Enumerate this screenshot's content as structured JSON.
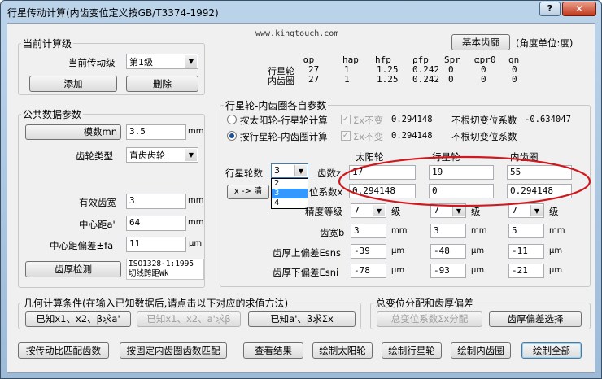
{
  "window": {
    "title": "行星传动计算(内齿变位定义按GB/T3374-1992)",
    "help_label": "?",
    "close_label": "✕"
  },
  "header": {
    "watermark": "www.kingtouch.com",
    "basic_gear_button": "基本齿廓",
    "angle_unit": "(角度单位:度)"
  },
  "current_stage": {
    "group_title": "当前计算级",
    "stage_label": "当前传动级",
    "stage_value": "第1级",
    "add_button": "添加",
    "delete_button": "删除"
  },
  "param_table": {
    "headers": [
      "αp",
      "hap",
      "hfp",
      "ρfp",
      "Spr",
      "αpr0",
      "qn"
    ],
    "rows": [
      {
        "name": "行星轮",
        "values": [
          "27",
          "1",
          "1.25",
          "0.242",
          "0",
          "0",
          "0"
        ]
      },
      {
        "name": "内齿圈",
        "values": [
          "27",
          "1",
          "1.25",
          "0.242",
          "0",
          "0",
          "0"
        ]
      }
    ]
  },
  "common": {
    "group_title": "公共数据参数",
    "module_button": "模数mn",
    "module_value": "3.5",
    "module_unit": "mm",
    "gear_type_label": "齿轮类型",
    "gear_type_value": "直齿齿轮",
    "face_width_label": "有效齿宽",
    "face_width_value": "3",
    "face_width_unit": "mm",
    "center_label": "中心距a'",
    "center_value": "64",
    "center_unit": "mm",
    "center_dev_label": "中心距偏差±fa",
    "center_dev_value": "11",
    "center_dev_unit": "μm",
    "tooth_check_button": "齿厚检测",
    "tooth_check_value_1": "ISO1328-1:1995",
    "tooth_check_value_2": "切线跨距Wk"
  },
  "modification": {
    "group_title": "行星轮-内齿圈各自参数",
    "radio1_label": "按太阳轮-行星轮计算",
    "radio1_checked": false,
    "radio1_sigma_label": "Σx不变",
    "radio1_sigma_value": "0.294148",
    "radio1_root_label": "不根切变位系数",
    "radio1_root_value": "-0.634047",
    "radio2_label": "按行星轮-内齿圈计算",
    "radio2_checked": true,
    "radio2_sigma_label": "Σx不变",
    "radio2_sigma_value": "0.294148",
    "radio2_root_label": "不根切变位系数",
    "planet_count_label": "行星轮数",
    "planet_count_value": "3",
    "planet_count_options": [
      "2",
      "3",
      "4"
    ],
    "planet_count_selected": "3",
    "clear_button": "x -> 清",
    "teeth_label": "齿数z",
    "shift_label": "位系数x",
    "columns": [
      "太阳轮",
      "行星轮",
      "内齿圈"
    ],
    "teeth": [
      "17",
      "19",
      "55"
    ],
    "shift": [
      "0.294148",
      "0",
      "0.294148"
    ],
    "accuracy_label": "精度等级",
    "accuracy_grade_unit": "级",
    "accuracy": [
      "7",
      "7",
      "7"
    ],
    "width_label": "齿宽b",
    "width_unit": "mm",
    "width": [
      "3",
      "3",
      "5"
    ],
    "upper_dev_label": "齿厚上偏差Esns",
    "upper_dev_unit": "μm",
    "upper_dev": [
      "-39",
      "-48",
      "-11"
    ],
    "lower_dev_label": "齿厚下偏差Esni",
    "lower_dev_unit": "μm",
    "lower_dev": [
      "-78",
      "-93",
      "-21"
    ],
    "ellipse_color": "#d0191e"
  },
  "geometry": {
    "group_title": "几何计算条件(在输入已知数据后,请点击以下对应的求值方法)",
    "btn1": "已知x1、x2、β求a'",
    "btn2": "已知x1、x2、a'求β",
    "btn3": "已知a'、β求Σx"
  },
  "distribution": {
    "group_title": "总变位分配和齿厚偏差",
    "btn1": "总变位系数Σx分配",
    "btn2": "齿厚偏差选择"
  },
  "bottom": {
    "btn_ratio": "按传动比匹配齿数",
    "btn_ring": "按固定内齿圈齿数匹配",
    "btn_result": "查看结果",
    "btn_sun": "绘制太阳轮",
    "btn_planet": "绘制行星轮",
    "btn_ring_draw": "绘制内齿圈",
    "btn_all": "绘制全部"
  }
}
